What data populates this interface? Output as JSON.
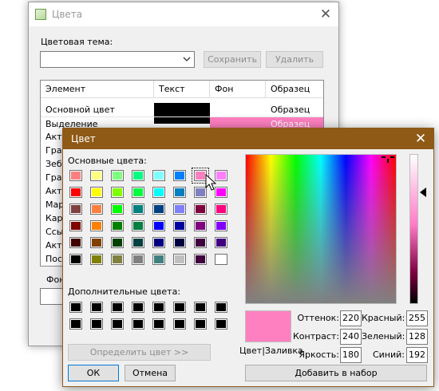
{
  "back_window": {
    "title": "Цвета",
    "theme_label": "Цветовая тема:",
    "theme_value": "",
    "save_label": "Сохранить",
    "delete_label": "Удалить",
    "columns": [
      "Элемент",
      "Текст",
      "Фон",
      "Образец"
    ],
    "rows": [
      {
        "element": "Основной цвет",
        "sample": "Образец",
        "text_color": "#000000",
        "bg_color": "#ffffff"
      },
      {
        "element": "Выделение",
        "sample": "Образец",
        "text_color": "#000000",
        "bg_color": "#ff80c0"
      },
      {
        "element": "Акти",
        "sample": "",
        "text_color": "",
        "bg_color": ""
      },
      {
        "element": "Гра",
        "sample": "",
        "text_color": "",
        "bg_color": ""
      },
      {
        "element": "Зеб",
        "sample": "",
        "text_color": "",
        "bg_color": ""
      },
      {
        "element": "Гра",
        "sample": "",
        "text_color": "",
        "bg_color": ""
      },
      {
        "element": "Акти",
        "sample": "",
        "text_color": "",
        "bg_color": ""
      },
      {
        "element": "Мар",
        "sample": "",
        "text_color": "",
        "bg_color": ""
      },
      {
        "element": "Кар",
        "sample": "",
        "text_color": "",
        "bg_color": ""
      },
      {
        "element": "Ссы",
        "sample": "",
        "text_color": "",
        "bg_color": ""
      },
      {
        "element": "Акти",
        "sample": "",
        "text_color": "",
        "bg_color": ""
      },
      {
        "element": "Пос",
        "sample": "",
        "text_color": "",
        "bg_color": ""
      }
    ],
    "font_label": "Фон"
  },
  "color_dialog": {
    "title": "Цвет",
    "basic_label": "Основные цвета:",
    "custom_label": "Дополнительные цвета:",
    "basic_colors": [
      [
        "#ff8080",
        "#ffff80",
        "#80ff80",
        "#00ff80",
        "#80ffff",
        "#0080ff",
        "#ff80c0",
        "#ff80ff"
      ],
      [
        "#ff0000",
        "#ffff00",
        "#80ff00",
        "#00ff40",
        "#00ffff",
        "#0080c0",
        "#8080c0",
        "#ff00ff"
      ],
      [
        "#804040",
        "#ff8040",
        "#00ff00",
        "#008080",
        "#004080",
        "#8080ff",
        "#800040",
        "#ff0080"
      ],
      [
        "#800000",
        "#ff8000",
        "#008000",
        "#008040",
        "#0000ff",
        "#0000a0",
        "#800080",
        "#8000ff"
      ],
      [
        "#400000",
        "#804000",
        "#004000",
        "#004040",
        "#000080",
        "#000040",
        "#400040",
        "#400080"
      ],
      [
        "#000000",
        "#808000",
        "#808040",
        "#808080",
        "#408080",
        "#c0c0c0",
        "#400040",
        "#ffffff"
      ]
    ],
    "selected_swatch": "#ff80c0",
    "custom_colors": [
      [
        "#000000",
        "#000000",
        "#000000",
        "#000000",
        "#000000",
        "#000000",
        "#000000",
        "#000000"
      ],
      [
        "#000000",
        "#000000",
        "#000000",
        "#000000",
        "#000000",
        "#000000",
        "#000000",
        "#000000"
      ]
    ],
    "define_label": "Определить цвет >>",
    "ok_label": "ОК",
    "cancel_label": "Отмена",
    "add_label": "Добавить в набор",
    "preview_label": "Цвет|Заливка",
    "preview_color": "#ff80c0",
    "fields": {
      "hue_label": "Оттенок:",
      "hue": "220",
      "sat_label": "Контраст:",
      "sat": "240",
      "lum_label": "Яркость:",
      "lum": "180",
      "red_label": "Красный:",
      "red": "255",
      "green_label": "Зеленый:",
      "green": "128",
      "blue_label": "Синий:",
      "blue": "192"
    }
  }
}
